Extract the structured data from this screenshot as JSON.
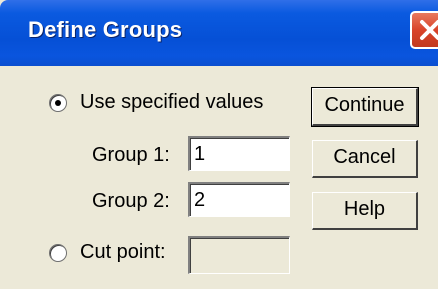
{
  "window": {
    "title": "Define Groups"
  },
  "options": {
    "use_specified_label": "Use specified values",
    "cut_point_label": "Cut point:",
    "selected": "use_specified"
  },
  "fields": {
    "group1_label": "Group 1:",
    "group1_value": "1",
    "group2_label": "Group 2:",
    "group2_value": "2",
    "cut_point_value": ""
  },
  "buttons": {
    "continue": "Continue",
    "cancel": "Cancel",
    "help": "Help"
  }
}
